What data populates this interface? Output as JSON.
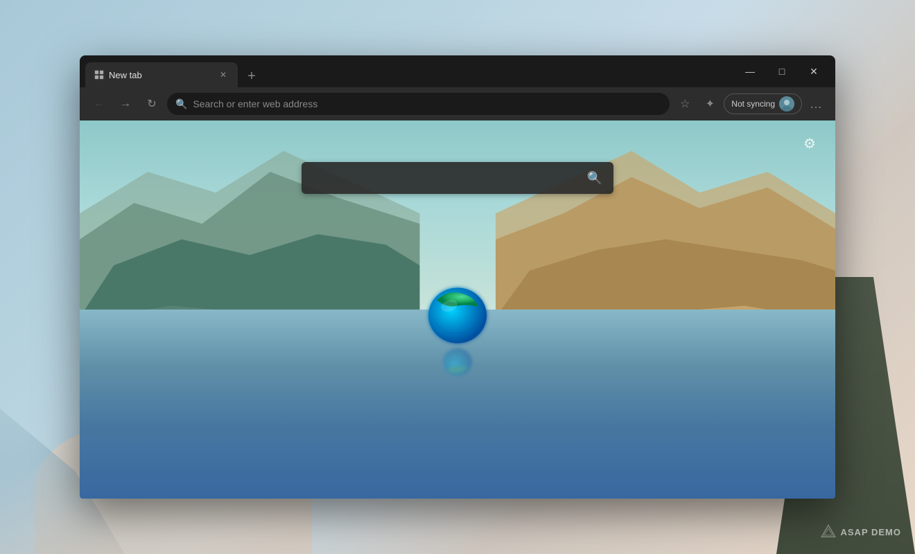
{
  "desktop": {
    "watermark": "ASAP DEMO"
  },
  "browser": {
    "tab": {
      "title": "New tab",
      "favicon": "grid-icon"
    },
    "window_controls": {
      "minimize": "—",
      "maximize": "□",
      "close": "✕"
    },
    "toolbar": {
      "back": "←",
      "forward": "→",
      "refresh": "↻",
      "search_placeholder": "Search or enter web address",
      "favorite": "☆",
      "collections": "✦",
      "sync_label": "Not syncing",
      "more": "…"
    },
    "new_tab_page": {
      "settings_label": "⚙",
      "search_placeholder": "",
      "search_icon": "🔍"
    }
  }
}
